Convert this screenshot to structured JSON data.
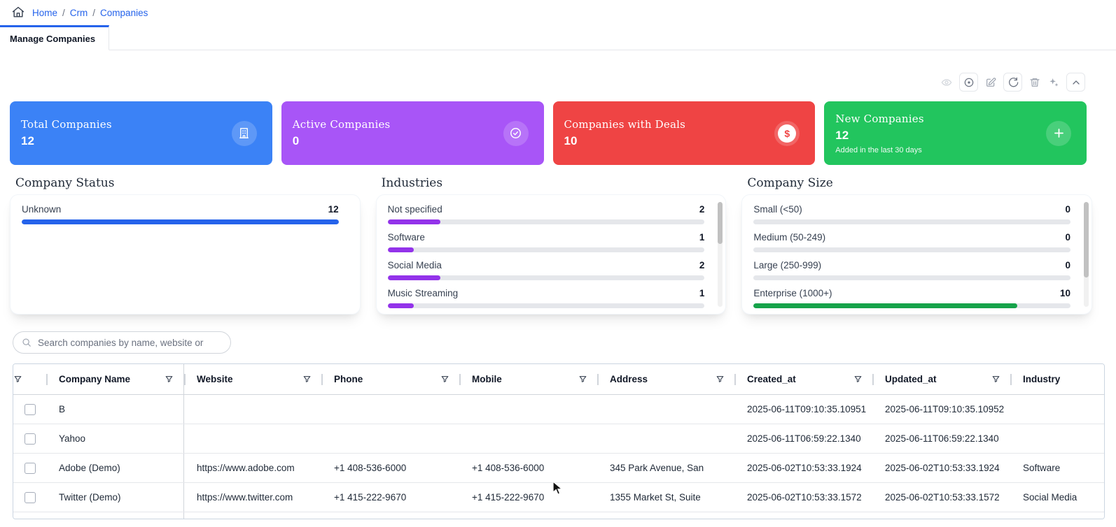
{
  "breadcrumb": {
    "items": [
      "Home",
      "Crm",
      "Companies"
    ],
    "separator": "/"
  },
  "tabs": {
    "active": "Manage Companies"
  },
  "toolbar": {
    "icons": [
      "eye-icon",
      "record-circle-icon",
      "edit-icon",
      "refresh-icon",
      "trash-icon",
      "sparkles-icon",
      "collapse-chevron-up-icon"
    ]
  },
  "stat_cards": [
    {
      "title": "Total Companies",
      "value": "12",
      "subtitle": "",
      "color": "#3b82f6",
      "icon": "building-icon"
    },
    {
      "title": "Active Companies",
      "value": "0",
      "subtitle": "",
      "color": "#a855f7",
      "icon": "check-circle-icon"
    },
    {
      "title": "Companies with Deals",
      "value": "10",
      "subtitle": "",
      "color": "#ef4444",
      "icon": "dollar-circle-icon"
    },
    {
      "title": "New Companies",
      "value": "12",
      "subtitle": "Added in the last 30 days",
      "color": "#22c55e",
      "icon": "plus-icon"
    }
  ],
  "panels": [
    {
      "title": "Company Status",
      "items": [
        {
          "label": "Unknown",
          "value": 12,
          "pct": 100,
          "bar_color": "#2563eb"
        }
      ]
    },
    {
      "title": "Industries",
      "items": [
        {
          "label": "Not specified",
          "value": 2,
          "pct": 16.7,
          "bar_color": "#9333ea"
        },
        {
          "label": "Software",
          "value": 1,
          "pct": 8.3,
          "bar_color": "#9333ea"
        },
        {
          "label": "Social Media",
          "value": 2,
          "pct": 16.7,
          "bar_color": "#9333ea"
        },
        {
          "label": "Music Streaming",
          "value": 1,
          "pct": 8.3,
          "bar_color": "#9333ea"
        }
      ],
      "scrollbar": {
        "thumb_top_pct": 0,
        "thumb_height_pct": 40
      }
    },
    {
      "title": "Company Size",
      "items": [
        {
          "label": "Small (<50)",
          "value": 0,
          "pct": 0,
          "bar_color": "#16a34a"
        },
        {
          "label": "Medium (50-249)",
          "value": 0,
          "pct": 0,
          "bar_color": "#16a34a"
        },
        {
          "label": "Large (250-999)",
          "value": 0,
          "pct": 0,
          "bar_color": "#16a34a"
        },
        {
          "label": "Enterprise (1000+)",
          "value": 10,
          "pct": 83.3,
          "bar_color": "#16a34a"
        }
      ],
      "scrollbar": {
        "thumb_top_pct": 0,
        "thumb_height_pct": 72
      }
    }
  ],
  "search": {
    "placeholder": "Search companies by name, website or"
  },
  "table": {
    "columns": [
      "Company Name",
      "Website",
      "Phone",
      "Mobile",
      "Address",
      "Created_at",
      "Updated_at",
      "Industry"
    ],
    "rows": [
      {
        "name": "B",
        "website": "",
        "phone": "",
        "mobile": "",
        "address": "",
        "created_at": "2025-06-11T09:10:35.10951",
        "updated_at": "2025-06-11T09:10:35.10952",
        "industry": ""
      },
      {
        "name": "Yahoo",
        "website": "",
        "phone": "",
        "mobile": "",
        "address": "",
        "created_at": "2025-06-11T06:59:22.1340",
        "updated_at": "2025-06-11T06:59:22.1340",
        "industry": ""
      },
      {
        "name": "Adobe (Demo)",
        "website": "https://www.adobe.com",
        "phone": "+1 408-536-6000",
        "mobile": "+1 408-536-6000",
        "address": "345 Park Avenue, San",
        "created_at": "2025-06-02T10:53:33.1924",
        "updated_at": "2025-06-02T10:53:33.1924",
        "industry": "Software"
      },
      {
        "name": "Twitter (Demo)",
        "website": "https://www.twitter.com",
        "phone": "+1 415-222-9670",
        "mobile": "+1 415-222-9670",
        "address": "1355 Market St, Suite",
        "created_at": "2025-06-02T10:53:33.1572",
        "updated_at": "2025-06-02T10:53:33.1572",
        "industry": "Social Media"
      }
    ]
  }
}
